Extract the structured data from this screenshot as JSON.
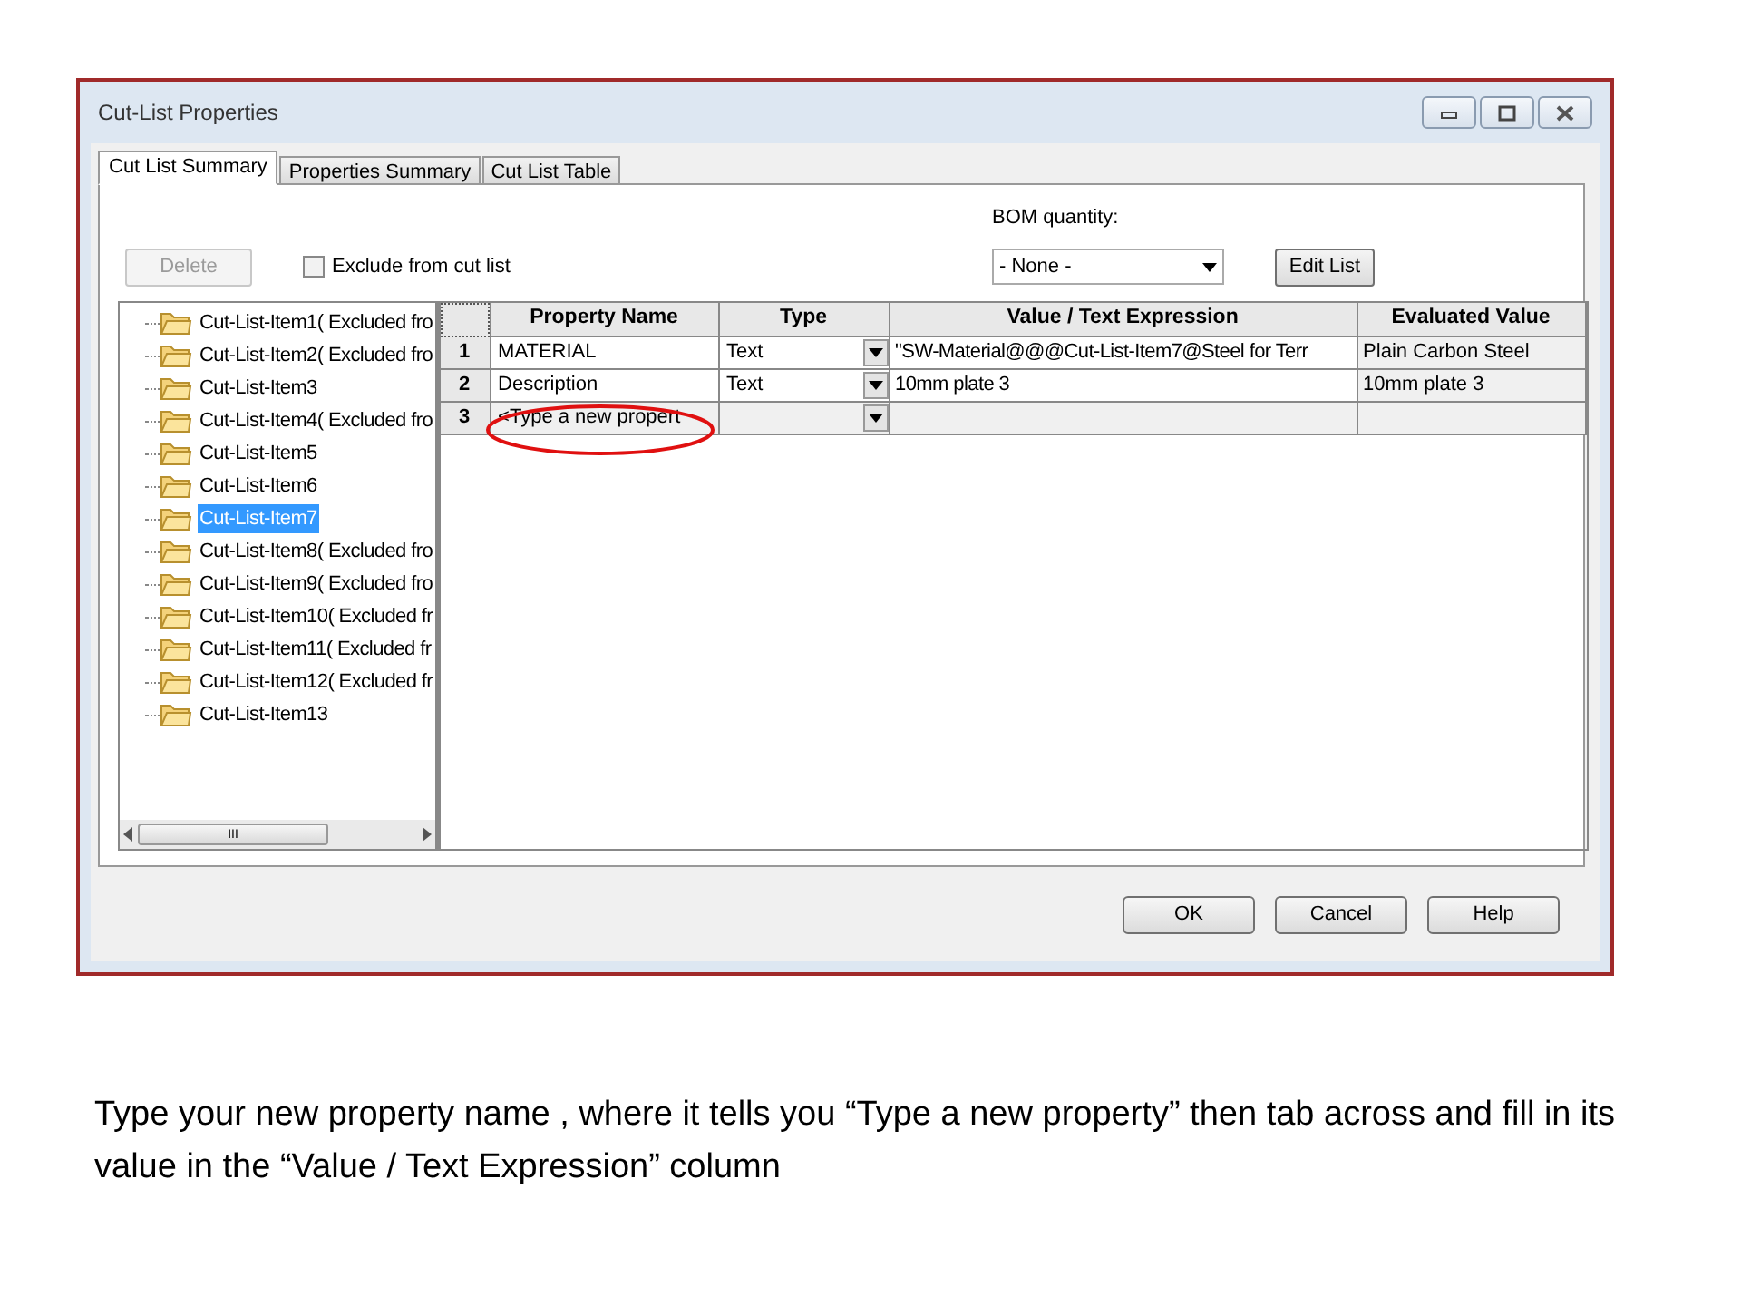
{
  "window": {
    "title": "Cut-List Properties"
  },
  "tabs": [
    {
      "label": "Cut List Summary",
      "selected": true
    },
    {
      "label": "Properties Summary",
      "selected": false
    },
    {
      "label": "Cut List Table",
      "selected": false
    }
  ],
  "delete_button": {
    "label": "Delete",
    "disabled": true
  },
  "exclude_checkbox": {
    "label": "Exclude from cut list",
    "checked": false
  },
  "bom_quantity": {
    "label": "BOM quantity:",
    "value": "- None -"
  },
  "edit_list_button": "Edit List",
  "tree": {
    "items": [
      {
        "label": "Cut-List-Item1( Excluded fro",
        "selected": false
      },
      {
        "label": "Cut-List-Item2( Excluded fro",
        "selected": false
      },
      {
        "label": "Cut-List-Item3",
        "selected": false
      },
      {
        "label": "Cut-List-Item4( Excluded fro",
        "selected": false
      },
      {
        "label": "Cut-List-Item5",
        "selected": false
      },
      {
        "label": "Cut-List-Item6",
        "selected": false
      },
      {
        "label": "Cut-List-Item7",
        "selected": true
      },
      {
        "label": "Cut-List-Item8( Excluded fro",
        "selected": false
      },
      {
        "label": "Cut-List-Item9( Excluded fro",
        "selected": false
      },
      {
        "label": "Cut-List-Item10( Excluded fr",
        "selected": false
      },
      {
        "label": "Cut-List-Item11( Excluded fr",
        "selected": false
      },
      {
        "label": "Cut-List-Item12( Excluded fr",
        "selected": false
      },
      {
        "label": "Cut-List-Item13",
        "selected": false
      }
    ],
    "scrollbar_grip": "III"
  },
  "table": {
    "columns": [
      "Property Name",
      "Type",
      "Value / Text Expression",
      "Evaluated Value"
    ],
    "rows": [
      {
        "number": "1",
        "name": "MATERIAL",
        "type": "Text",
        "value": "\"SW-Material@@@Cut-List-Item7@Steel for Terr",
        "evaluated": "Plain Carbon Steel"
      },
      {
        "number": "2",
        "name": "Description",
        "type": "Text",
        "value": "10mm plate 3",
        "evaluated": "10mm plate 3"
      },
      {
        "number": "3",
        "name": "<Type a new propert",
        "type": "",
        "value": "",
        "evaluated": ""
      }
    ]
  },
  "buttons": [
    "OK",
    "Cancel",
    "Help"
  ],
  "caption": "Type your new property name , where it tells you “Type a new property” then tab across and fill in its value in the “Value / Text Expression” column"
}
